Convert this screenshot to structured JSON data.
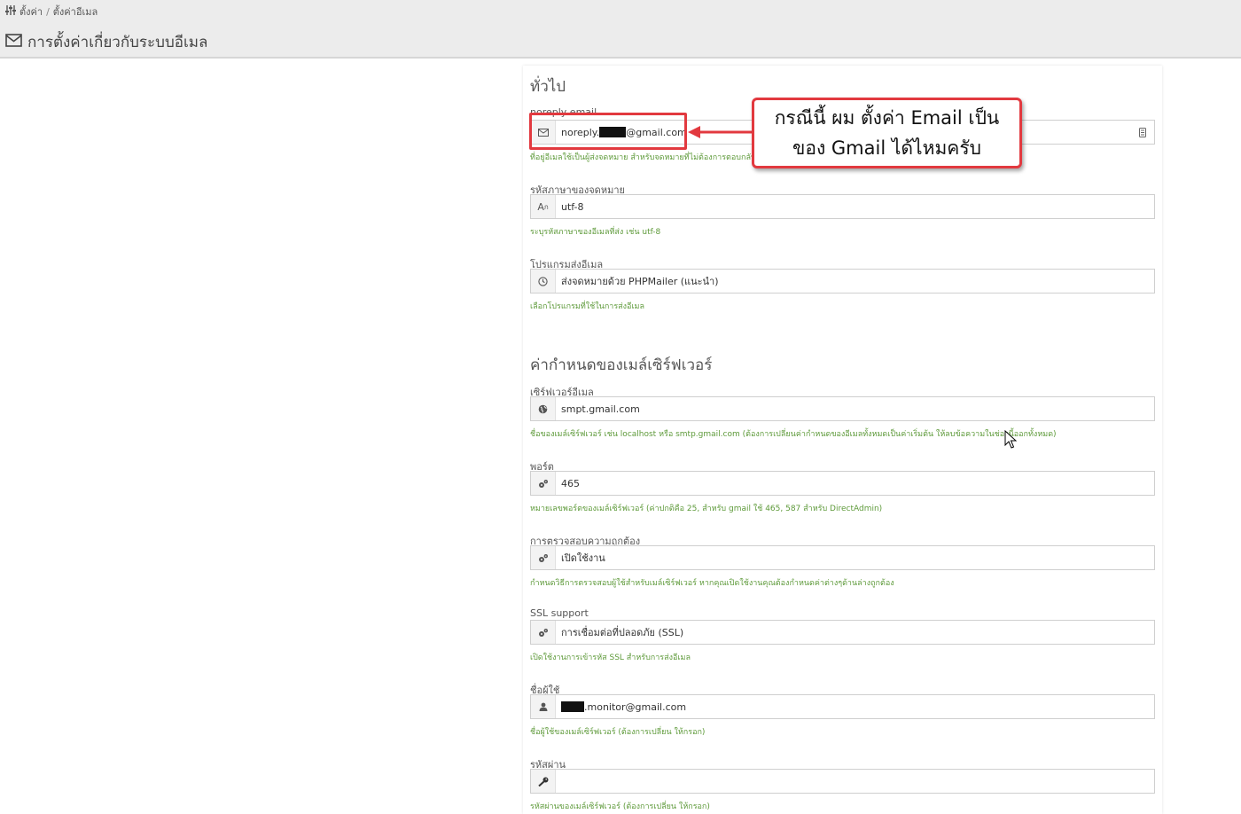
{
  "breadcrumb": {
    "icon": "sliders-icon",
    "root": "ตั้งค่า",
    "separator": "/",
    "current": "ตั้งค่าอีเมล"
  },
  "page": {
    "title_icon": "envelope-icon",
    "title": "การตั้งค่าเกี่ยวกับระบบอีเมล"
  },
  "general": {
    "section_title": "ทั่วไป",
    "noreply": {
      "label": "noreply email",
      "value_prefix": "noreply.",
      "value_suffix": "@gmail.com",
      "hint": "ที่อยู่อีเมลใช้เป็นผู้ส่งจดหมาย สำหรับจดหมายที่ไม่ต้องการตอบกลับ"
    },
    "charset": {
      "label": "รหัสภาษาของจดหมาย",
      "value": "utf-8",
      "hint": "ระบุรหัสภาษาของอีเมลที่ส่ง เช่น utf-8"
    },
    "mailer": {
      "label": "โปรแกรมส่งอีเมล",
      "value": "ส่งจดหมายด้วย PHPMailer (แนะนำ)",
      "hint": "เลือกโปรแกรมที่ใช้ในการส่งอีเมล"
    }
  },
  "server": {
    "section_title": "ค่ากำหนดของเมล์เซิร์ฟเวอร์",
    "host": {
      "label": "เซิร์ฟเวอร์อีเมล",
      "value": "smpt.gmail.com",
      "hint": "ชื่อของเมล์เซิร์ฟเวอร์ เช่น localhost หรือ smtp.gmail.com (ต้องการเปลี่ยนค่ากำหนดของอีเมลทั้งหมดเป็นค่าเริ่มต้น ให้ลบข้อความในช่องนี้ออกทั้งหมด)"
    },
    "port": {
      "label": "พอร์ต",
      "value": "465",
      "hint": "หมายเลขพอร์ตของเมล์เซิร์ฟเวอร์ (ค่าปกติคือ 25, สำหรับ gmail ใช้ 465, 587 สำหรับ DirectAdmin)"
    },
    "auth": {
      "label": "การตรวจสอบความถูกต้อง",
      "value": "เปิดใช้งาน",
      "hint": "กำหนดวิธีการตรวจสอบผู้ใช้สำหรับเมล์เซิร์ฟเวอร์ หากคุณเปิดใช้งานคุณต้องกำหนดค่าต่างๆด้านล่างถูกต้อง"
    },
    "ssl": {
      "label": "SSL support",
      "value": "การเชื่อมต่อที่ปลอดภัย (SSL)",
      "hint": "เปิดใช้งานการเข้ารหัส SSL สำหรับการส่งอีเมล"
    },
    "username": {
      "label": "ชื่อผู้ใช้",
      "value_suffix": ".monitor@gmail.com",
      "hint": "ชื่อผู้ใช้ของเมล์เซิร์ฟเวอร์ (ต้องการเปลี่ยน ให้กรอก)"
    },
    "password": {
      "label": "รหัสผ่าน",
      "value": "",
      "hint": "รหัสผ่านของเมล์เซิร์ฟเวอร์ (ต้องการเปลี่ยน ให้กรอก)"
    }
  },
  "annotation": {
    "line1": "กรณีนี้ ผม ตั้งค่า Email เป็น",
    "line2": "ของ Gmail ได้ไหมครับ",
    "color": "#e2393f"
  },
  "colors": {
    "hint": "#5e9a3a",
    "topbar": "#ececec"
  }
}
